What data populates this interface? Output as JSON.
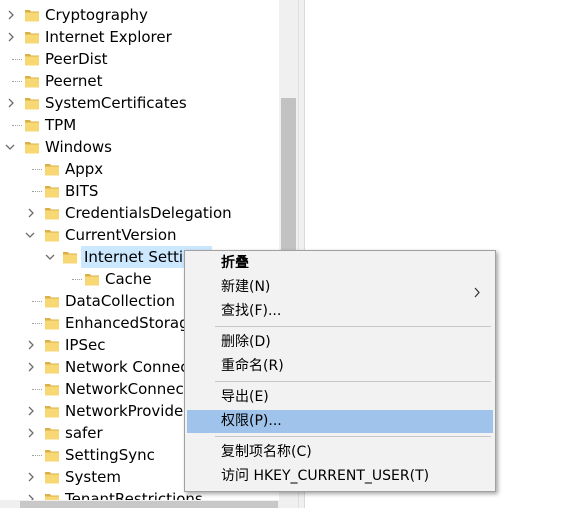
{
  "tree": {
    "items": [
      {
        "label": "Cryptography",
        "expander": "right"
      },
      {
        "label": "Internet Explorer",
        "expander": "right"
      },
      {
        "label": "PeerDist",
        "expander": "none"
      },
      {
        "label": "Peernet",
        "expander": "none"
      },
      {
        "label": "SystemCertificates",
        "expander": "right"
      },
      {
        "label": "TPM",
        "expander": "none"
      },
      {
        "label": "Windows",
        "expander": "down"
      },
      {
        "label": "Appx",
        "expander": "none"
      },
      {
        "label": "BITS",
        "expander": "none"
      },
      {
        "label": "CredentialsDelegation",
        "expander": "right"
      },
      {
        "label": "CurrentVersion",
        "expander": "down"
      },
      {
        "label": "Internet Settings",
        "expander": "down",
        "selected": true
      },
      {
        "label": "Cache",
        "expander": "none"
      },
      {
        "label": "DataCollection",
        "expander": "none"
      },
      {
        "label": "EnhancedStorageDevices",
        "expander": "none"
      },
      {
        "label": "IPSec",
        "expander": "right"
      },
      {
        "label": "Network Connections",
        "expander": "right"
      },
      {
        "label": "NetworkConnectivityStatusIndicator",
        "expander": "none"
      },
      {
        "label": "NetworkProvider",
        "expander": "right"
      },
      {
        "label": "safer",
        "expander": "right"
      },
      {
        "label": "SettingSync",
        "expander": "none"
      },
      {
        "label": "System",
        "expander": "right"
      },
      {
        "label": "TenantRestrictions",
        "expander": "right"
      }
    ]
  },
  "context_menu": {
    "items": [
      {
        "label": "折叠",
        "bold": true
      },
      {
        "label": "新建(N)",
        "submenu": true
      },
      {
        "label": "查找(F)..."
      },
      {
        "label": "删除(D)"
      },
      {
        "label": "重命名(R)"
      },
      {
        "label": "导出(E)"
      },
      {
        "label": "权限(P)...",
        "highlighted": true
      },
      {
        "label": "复制项名称(C)"
      },
      {
        "label": "访问 HKEY_CURRENT_USER(T)"
      }
    ]
  },
  "colors": {
    "folder_yellow": "#f8d775",
    "folder_dark": "#dcb045",
    "selection": "#cce8ff",
    "menu_highlight": "#9fc3ea",
    "menu_bg": "#f2f2f2"
  },
  "icons": {
    "folder": "folder-icon",
    "expand": "chevron-right-icon",
    "collapse": "chevron-down-icon",
    "submenu": "chevron-right-icon"
  }
}
